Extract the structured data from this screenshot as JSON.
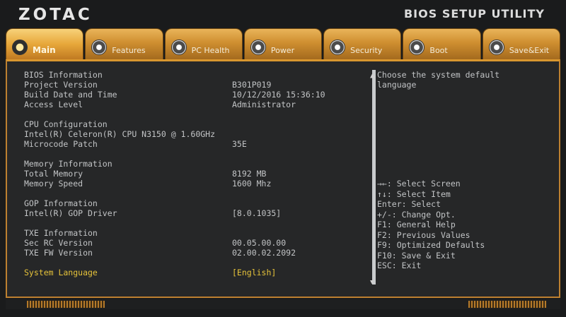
{
  "header": {
    "brand": "ZOTAC",
    "utility_title": "BIOS SETUP UTILITY"
  },
  "tabs": [
    {
      "label": "Main",
      "icon": "main-icon",
      "active": true
    },
    {
      "label": "Features",
      "icon": "features-icon",
      "active": false
    },
    {
      "label": "PC Health",
      "icon": "pc-health-icon",
      "active": false
    },
    {
      "label": "Power",
      "icon": "power-icon",
      "active": false
    },
    {
      "label": "Security",
      "icon": "security-icon",
      "active": false
    },
    {
      "label": "Boot",
      "icon": "boot-icon",
      "active": false
    },
    {
      "label": "Save&Exit",
      "icon": "save-exit-icon",
      "active": false
    }
  ],
  "info": {
    "bios_heading": "BIOS Information",
    "project_version_label": "Project Version",
    "project_version": "B301P019",
    "build_date_label": "Build Date and Time",
    "build_date": "10/12/2016 15:36:10",
    "access_level_label": "Access Level",
    "access_level": "Administrator",
    "cpu_heading": "CPU Configuration",
    "cpu_name": "Intel(R) Celeron(R) CPU N3150 @ 1.60GHz",
    "microcode_label": "Microcode Patch",
    "microcode": "35E",
    "memory_heading": "Memory Information",
    "total_memory_label": "Total Memory",
    "total_memory": "8192 MB",
    "memory_speed_label": "Memory Speed",
    "memory_speed": "1600 Mhz",
    "gop_heading": "GOP Information",
    "gop_driver_label": "Intel(R) GOP Driver",
    "gop_driver": "[8.0.1035]",
    "txe_heading": "TXE Information",
    "sec_rc_label": "Sec RC Version",
    "sec_rc": "00.05.00.00",
    "txe_fw_label": "TXE FW Version",
    "txe_fw": "02.00.02.2092",
    "system_language_label": "System Language",
    "system_language": "[English]"
  },
  "help": {
    "description": "Choose the system default language",
    "keys": [
      "→←: Select Screen",
      "↑↓: Select Item",
      "Enter: Select",
      "+/-: Change Opt.",
      "F1: General Help",
      "F2: Previous Values",
      "F9: Optimized Defaults",
      "F10: Save & Exit",
      "ESC: Exit"
    ]
  },
  "colors": {
    "accent": "#d9972f",
    "selected_text": "#e6c33a",
    "text": "#c2c4c6",
    "background": "#262728"
  }
}
